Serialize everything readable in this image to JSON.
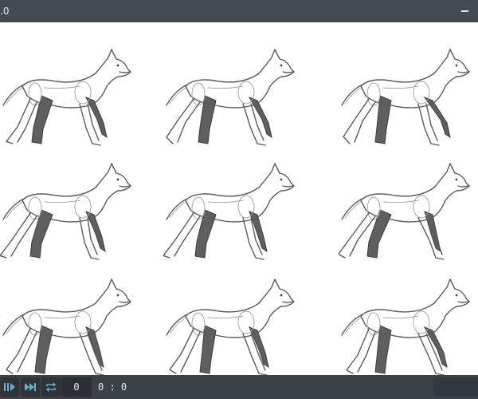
{
  "window": {
    "title_fragment": ".0"
  },
  "canvas": {
    "frames": [
      {
        "id": 1,
        "name": "frame-1"
      },
      {
        "id": 2,
        "name": "frame-2"
      },
      {
        "id": 3,
        "name": "frame-3"
      },
      {
        "id": 4,
        "name": "frame-4"
      },
      {
        "id": 5,
        "name": "frame-5"
      },
      {
        "id": 6,
        "name": "frame-6"
      },
      {
        "id": 7,
        "name": "frame-7"
      },
      {
        "id": 8,
        "name": "frame-8"
      },
      {
        "id": 9,
        "name": "frame-9"
      }
    ]
  },
  "playback": {
    "play_pause_icon": "play-pause-icon",
    "next_frame_icon": "skip-forward-icon",
    "loop_icon": "loop-icon",
    "frame_value": "0",
    "timecode": "0 : 0"
  },
  "colors": {
    "chrome": "#3c4148",
    "titlebar": "#454a52",
    "accent": "#5fb3d3",
    "canvas": "#ffffff"
  }
}
